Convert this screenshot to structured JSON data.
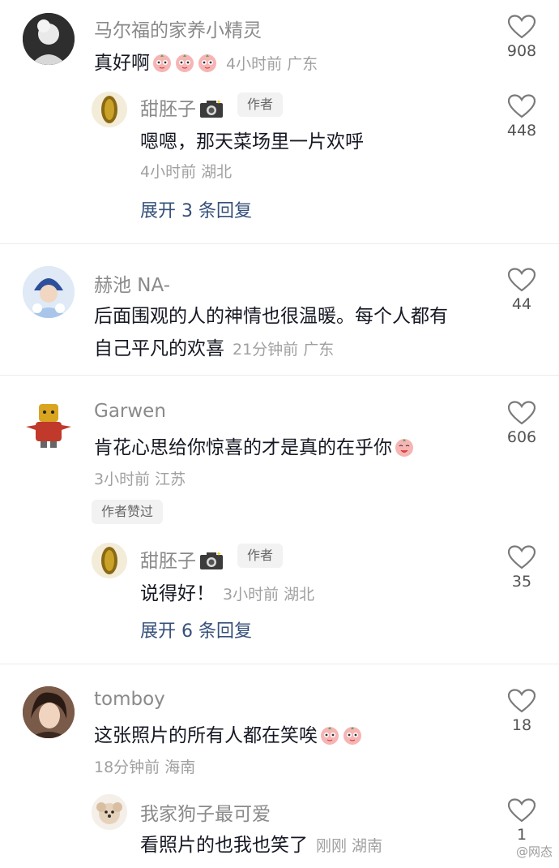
{
  "comments": [
    {
      "user": "马尔福的家养小精灵",
      "text": "真好啊",
      "emoji_count": 3,
      "meta": "4小时前 广东",
      "likes": "908",
      "reply": {
        "user": "甜胚子",
        "badge": "作者",
        "text": "嗯嗯，那天菜场里一片欢呼",
        "meta": "4小时前 湖北",
        "likes": "448"
      },
      "expand": "展开 3 条回复"
    },
    {
      "user": "赫池 NA-",
      "text_line1": "后面围观的人的神情也很温暖。每个人都有",
      "text_line2": "自己平凡的欢喜",
      "meta": "21分钟前 广东",
      "likes": "44"
    },
    {
      "user": "Garwen",
      "text": "肯花心思给你惊喜的才是真的在乎你",
      "emoji_count": 1,
      "meta": "3小时前 江苏",
      "likes": "606",
      "author_liked": "作者赞过",
      "reply": {
        "user": "甜胚子",
        "badge": "作者",
        "text": "说得好！",
        "meta": "3小时前 湖北",
        "likes": "35"
      },
      "expand": "展开 6 条回复"
    },
    {
      "user": "tomboy",
      "text": "这张照片的所有人都在笑唉",
      "emoji_count": 2,
      "meta": "18分钟前 海南",
      "likes": "18",
      "reply": {
        "user": "我家狗子最可爱",
        "text": "看照片的也我也笑了",
        "meta": "刚刚 湖南",
        "likes": "1"
      }
    }
  ],
  "watermark": "@网态",
  "icons": {
    "heart": "heart-outline-icon",
    "emoji": "peach-emoji-icon",
    "camera": "camera-icon"
  },
  "colors": {
    "text": "#161823",
    "username": "#8a8a8a",
    "meta": "#a0a0a0",
    "expand": "#35507a"
  }
}
